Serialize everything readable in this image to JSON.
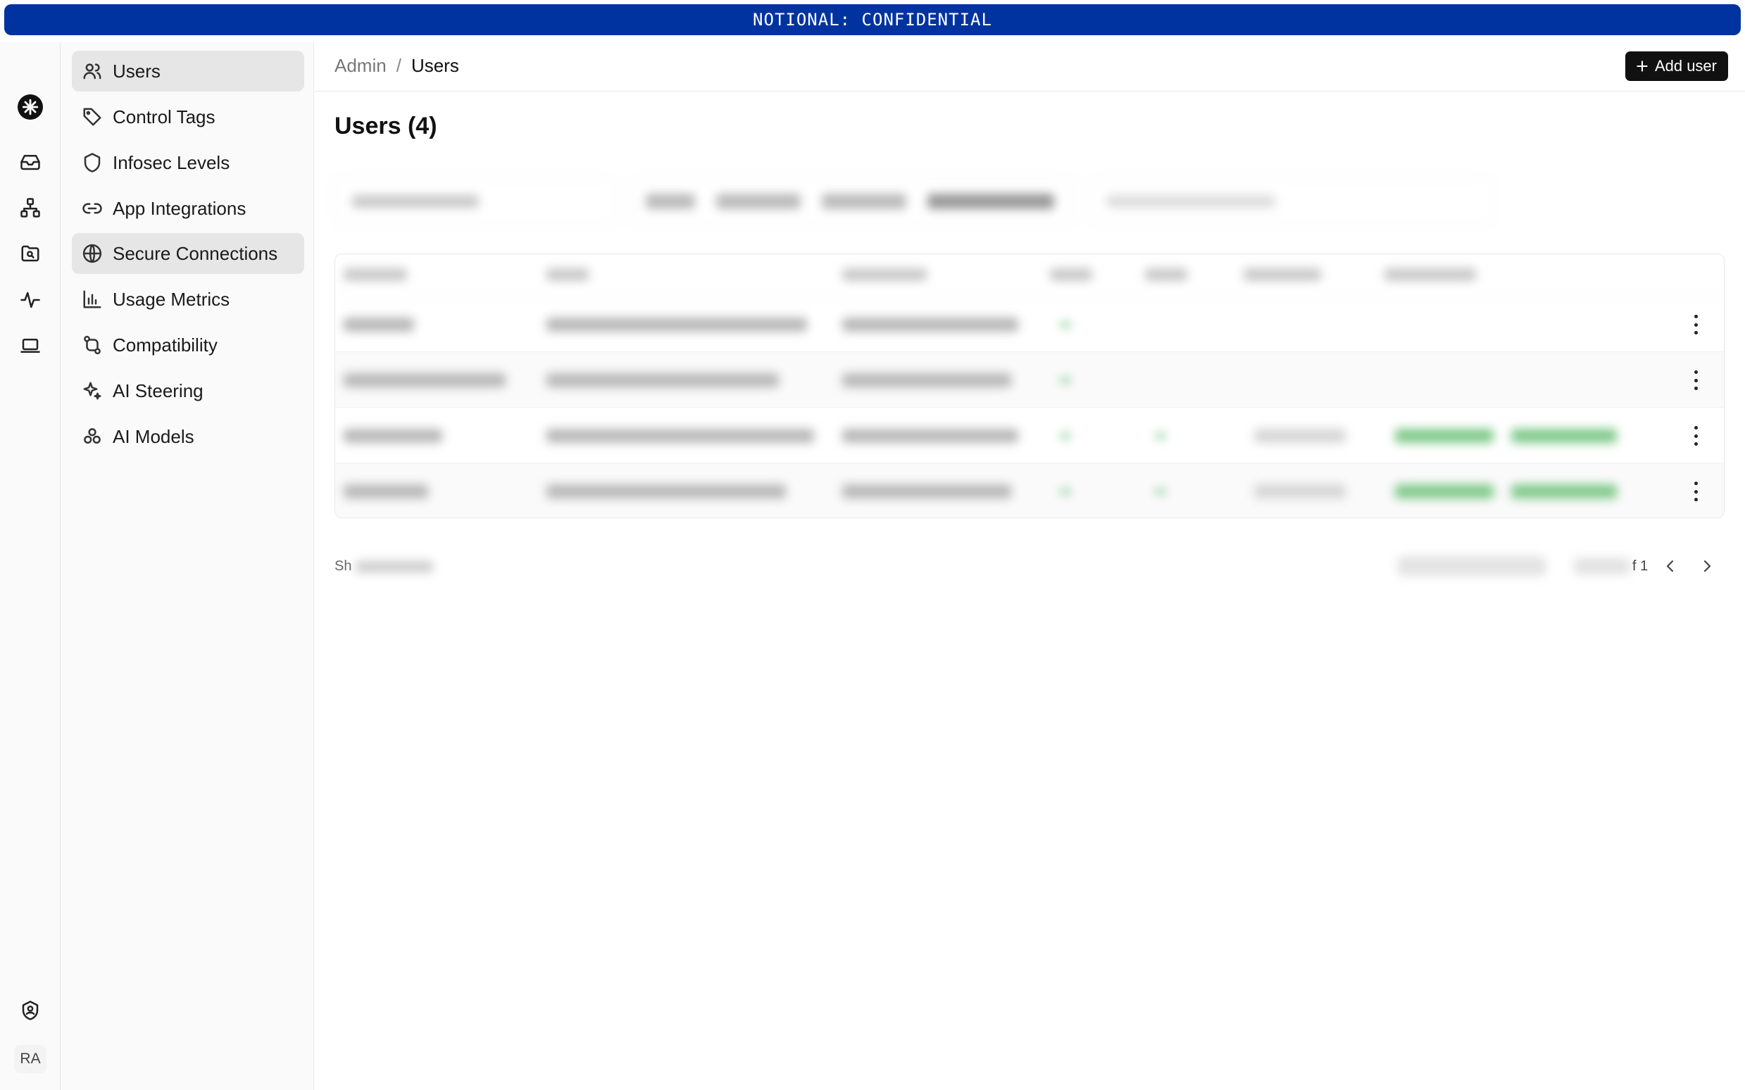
{
  "banner": {
    "text": "NOTIONAL: CONFIDENTIAL"
  },
  "rail": {
    "icons": [
      "logo-icon",
      "inbox-icon",
      "hierarchy-icon",
      "folder-search-icon",
      "activity-icon",
      "laptop-icon",
      "shield-user-icon",
      "document-icon"
    ],
    "avatar": "RA"
  },
  "subnav": {
    "items": [
      {
        "label": "Users",
        "icon": "users-icon",
        "active": true
      },
      {
        "label": "Control Tags",
        "icon": "tag-icon"
      },
      {
        "label": "Infosec Levels",
        "icon": "shield-icon"
      },
      {
        "label": "App Integrations",
        "icon": "link-icon"
      },
      {
        "label": "Secure Connections",
        "icon": "globe-icon",
        "active": true
      },
      {
        "label": "Usage Metrics",
        "icon": "bar-chart-icon"
      },
      {
        "label": "Compatibility",
        "icon": "git-compare-icon"
      },
      {
        "label": "AI Steering",
        "icon": "sparkles-icon"
      },
      {
        "label": "AI Models",
        "icon": "models-icon"
      }
    ]
  },
  "header": {
    "breadcrumb": [
      "Admin",
      "Users"
    ],
    "separator": "/",
    "add_button": "Add user"
  },
  "main": {
    "title": "Users (4)",
    "footer_left": "Sh",
    "pager_suffix": "f 1"
  },
  "colors": {
    "banner": "#0033a0",
    "accent": "#111111",
    "status_green": "#7fc98a"
  }
}
